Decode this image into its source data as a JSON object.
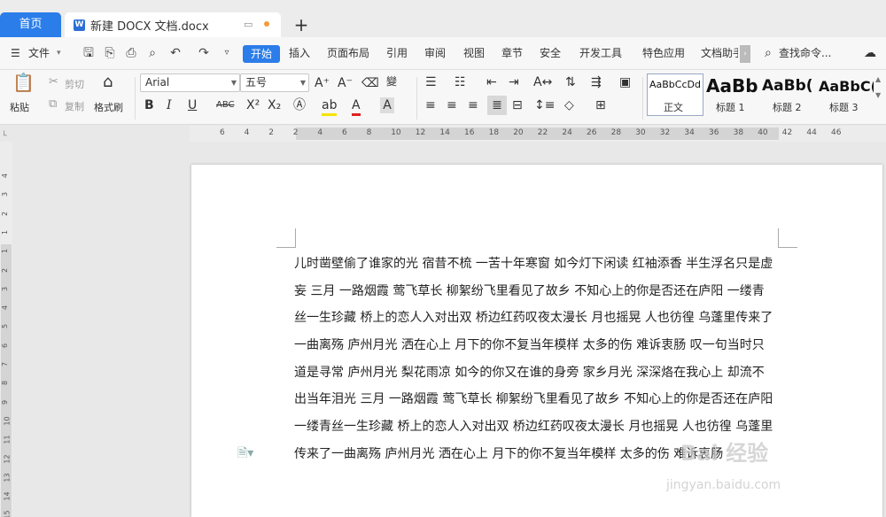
{
  "tabs": {
    "home": "首页",
    "doc_title": "新建 DOCX 文档.docx",
    "new_tab": "+"
  },
  "menu": {
    "file": "文件",
    "items": [
      "开始",
      "插入",
      "页面布局",
      "引用",
      "审阅",
      "视图",
      "章节",
      "安全",
      "开发工具",
      "特色应用",
      "文档助手"
    ],
    "search": "查找命令..."
  },
  "ribbon": {
    "paste": "粘贴",
    "cut": "剪切",
    "copy": "复制",
    "format_painter": "格式刷",
    "font_name": "Arial",
    "font_size": "五号",
    "styles": [
      {
        "sample": "AaBbCcDd",
        "name": "正文"
      },
      {
        "sample": "AaBb",
        "name": "标题 1"
      },
      {
        "sample": "AaBb(",
        "name": "标题 2"
      },
      {
        "sample": "AaBbC(",
        "name": "标题 3"
      }
    ]
  },
  "ruler": {
    "h_ticks": [
      "6",
      "4",
      "2",
      "2",
      "4",
      "6",
      "8",
      "10",
      "12",
      "14",
      "16",
      "18",
      "20",
      "22",
      "24",
      "26",
      "28",
      "30",
      "32",
      "34",
      "36",
      "38",
      "40",
      "42",
      "44",
      "46"
    ],
    "v_ticks": [
      "4",
      "3",
      "2",
      "1",
      "1",
      "2",
      "3",
      "4",
      "5",
      "6",
      "7",
      "8",
      "9",
      "10",
      "11",
      "12",
      "13",
      "14",
      "15"
    ]
  },
  "document": {
    "lines": [
      "儿时凿壁偷了谁家的光 宿昔不梳 一苦十年寒窗 如今灯下闲读 红袖添香 半生浮名只是虚",
      "妄 三月 一路烟霞 莺飞草长 柳絮纷飞里看见了故乡 不知心上的你是否还在庐阳 一缕青",
      "丝一生珍藏 桥上的恋人入对出双 桥边红药叹夜太漫长 月也摇晃 人也彷徨 乌蓬里传来了",
      "一曲离殇 庐州月光 洒在心上 月下的你不复当年模样 太多的伤 难诉衷肠 叹一句当时只",
      "道是寻常 庐州月光 梨花雨凉 如今的你又在谁的身旁 家乡月光 深深烙在我心上 却流不",
      "出当年泪光 三月 一路烟霞 莺飞草长 柳絮纷飞里看见了故乡 不知心上的你是否还在庐阳",
      "一缕青丝一生珍藏 桥上的恋人入对出双 桥边红药叹夜太漫长 月也摇晃 人也彷徨 乌蓬里",
      "传来了一曲离殇 庐州月光 洒在心上 月下的你不复当年模样 太多的伤 难诉衷肠"
    ]
  },
  "watermark": {
    "main": "Bai 经验",
    "sub": "jingyan.baidu.com"
  }
}
